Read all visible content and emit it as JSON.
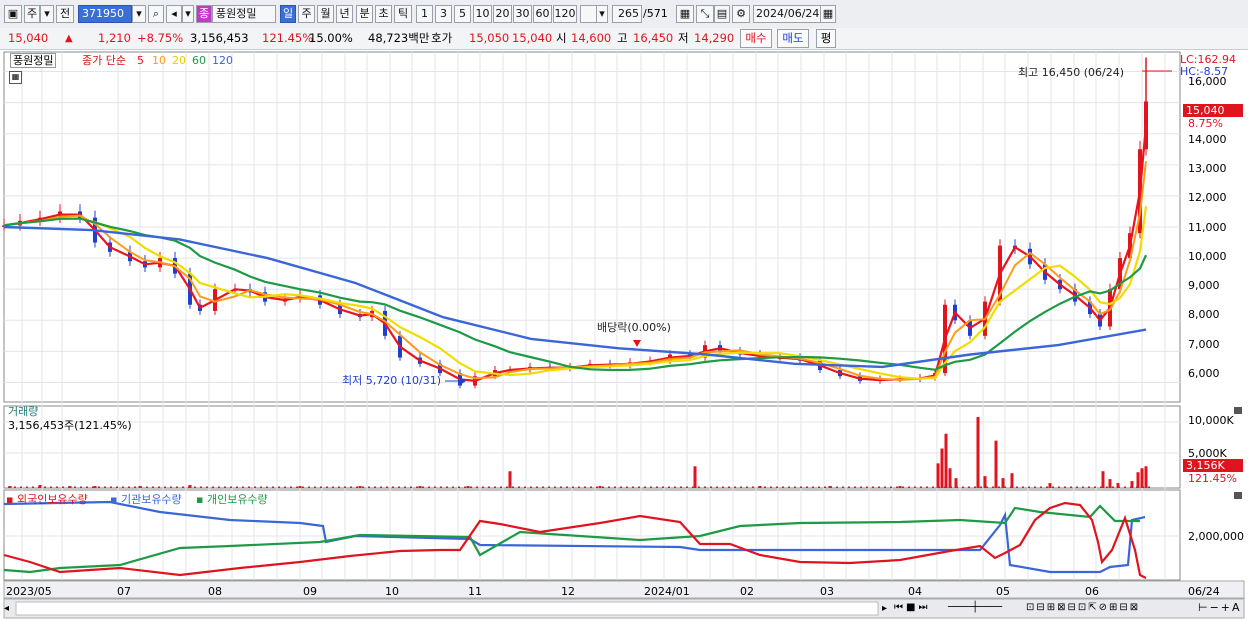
{
  "toolbar": {
    "market": "주",
    "jeon": "전",
    "code": "371950",
    "badge": "종",
    "name": "풍원정밀",
    "periods": [
      "일",
      "주",
      "월",
      "년",
      "분",
      "초",
      "틱"
    ],
    "intervals": [
      "1",
      "3",
      "5",
      "10",
      "20",
      "30",
      "60",
      "120"
    ],
    "count": "265",
    "total": "/571",
    "date": "2024/06/24"
  },
  "quote": {
    "price": "15,040",
    "arrow": "▲",
    "change": "1,210",
    "change_pct": "+8.75%",
    "volume": "3,156,453",
    "vol_ratio": "121.45%",
    "turnover": "15.00%",
    "amount": "48,723백만",
    "hoga_label": "호가",
    "ask": "15,050",
    "bid": "15,040",
    "open_label": "시",
    "open": "14,600",
    "high_label": "고",
    "high": "16,450",
    "low_label": "저",
    "low": "14,290",
    "buy": "매수",
    "sell": "매도",
    "pyeong": "평"
  },
  "price_panel": {
    "stock_label": "풍원정밀",
    "ma_title": "종가 단순",
    "ma_periods": [
      {
        "label": "5",
        "color": "#e8141e"
      },
      {
        "label": "10",
        "color": "#ff9a1a"
      },
      {
        "label": "20",
        "color": "#e8d000"
      },
      {
        "label": "60",
        "color": "#1e9a46"
      },
      {
        "label": "120",
        "color": "#3a66d8"
      }
    ],
    "lc": "LC:162.94",
    "hc": "HC:-8.57",
    "max_note": "최고 16,450 (06/24)",
    "min_note": "최저 5,720 (10/31)",
    "dividend_note": "배당락(0.00%)",
    "last_price": "15,040",
    "last_pct": "8.75%",
    "y_ticks": [
      "16,000",
      "15,000",
      "14,000",
      "13,000",
      "12,000",
      "11,000",
      "10,000",
      "9,000",
      "8,000",
      "7,000",
      "6,000"
    ]
  },
  "volume_panel": {
    "title": "거래량",
    "value": "3,156,453주(121.45%)",
    "y_ticks": [
      "10,000K",
      "5,000K"
    ],
    "last": "3,156K",
    "last_pct": "121.45%"
  },
  "holdings_panel": {
    "legend": [
      {
        "label": "외국인보유수량",
        "color": "#e0141e"
      },
      {
        "label": "기관보유수량",
        "color": "#3a66d8"
      },
      {
        "label": "개인보유수량",
        "color": "#1e9a46"
      }
    ],
    "y_tick": "2,000,000"
  },
  "x_axis": {
    "labels": [
      "2023/05",
      "07",
      "08",
      "09",
      "10",
      "11",
      "12",
      "2024/01",
      "02",
      "03",
      "04",
      "05",
      "06"
    ],
    "end_label": "06/24"
  },
  "colors": {
    "up": "#e0141e",
    "down": "#1f3fd0",
    "grid": "#e2e4e8"
  },
  "chart_data": {
    "type": "candlestick",
    "x": [
      "2023/05",
      "07",
      "08",
      "09",
      "10",
      "11",
      "12",
      "2024/01",
      "02",
      "03",
      "04",
      "05",
      "06",
      "06/24"
    ],
    "close": [
      11100,
      9900,
      8900,
      8600,
      7000,
      6300,
      6500,
      6700,
      6800,
      6000,
      6100,
      10400,
      7900,
      15040
    ],
    "ma120": [
      11000,
      10900,
      10600,
      10000,
      9200,
      8100,
      7400,
      7100,
      6900,
      6600,
      6500,
      6900,
      7200,
      7700
    ],
    "ylim": [
      5500,
      16500
    ],
    "max": {
      "value": 16450,
      "date": "06/24"
    },
    "min": {
      "value": 5720,
      "date": "10/31"
    },
    "volume_ylim": [
      0,
      12000
    ]
  }
}
